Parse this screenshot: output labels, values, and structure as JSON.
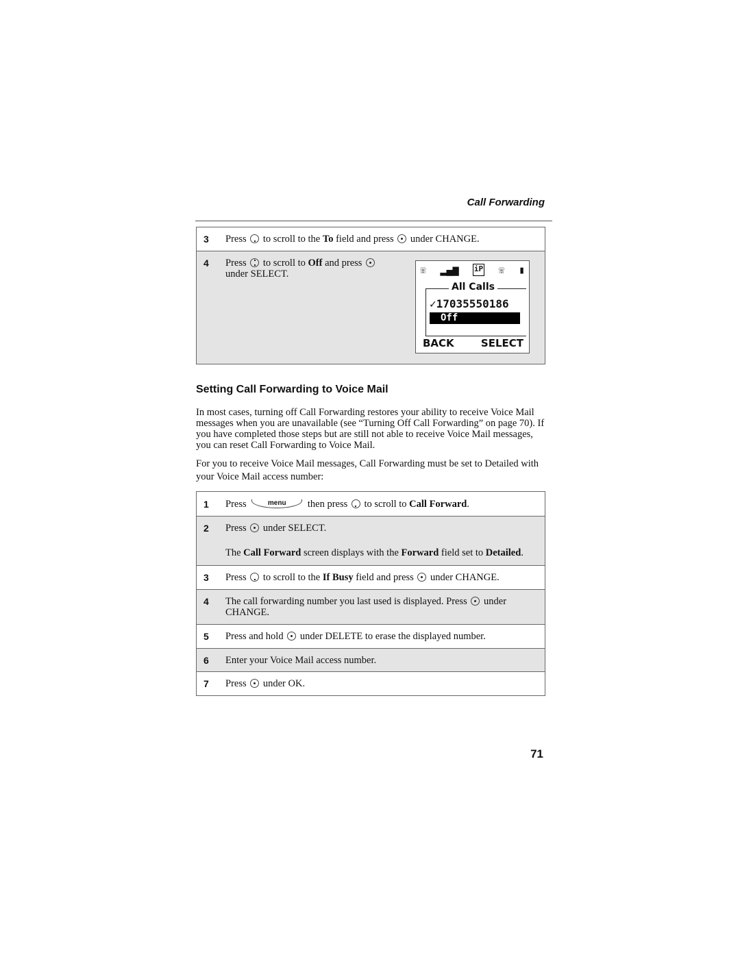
{
  "running_head": "Call Forwarding",
  "top_steps": [
    {
      "num": "3",
      "parts": [
        "Press",
        "to scroll to the",
        "To",
        "field and press",
        "under CHANGE."
      ]
    },
    {
      "num": "4",
      "parts": [
        "Press",
        "to scroll to",
        "Off",
        "and press",
        "under SELECT."
      ]
    }
  ],
  "phone_screen": {
    "status_icons": [
      "phone-icon",
      "signal-icon",
      "ip-icon",
      "phone-icon",
      "battery-icon"
    ],
    "frame_title": "All Calls",
    "check": "✓",
    "number": "17035550186",
    "highlight": "Off",
    "soft_left": "BACK",
    "soft_right": "SELECT"
  },
  "section": {
    "heading": "Setting Call Forwarding to Voice Mail",
    "para1": "In most cases, turning off Call Forwarding restores your ability to receive Voice Mail messages when you are unavailable (see “Turning Off Call Forwarding” on page 70). If you have completed those steps but are still not able to receive Voice Mail messages, you can reset Call Forwarding to Voice Mail.",
    "para2": "For you to receive Voice Mail messages, Call Forwarding must be set to Detailed with your Voice Mail access number:"
  },
  "steps": [
    {
      "num": "1",
      "parts": [
        "Press",
        "menu",
        "then press",
        "to scroll to",
        "Call Forward",
        "."
      ]
    },
    {
      "num": "2",
      "parts": [
        "Press",
        "under SELECT."
      ],
      "note": [
        "The",
        "Call Forward",
        "screen displays with the",
        "Forward",
        "field set to",
        "Detailed",
        "."
      ]
    },
    {
      "num": "3",
      "parts": [
        "Press",
        "to scroll to the",
        "If Busy",
        "field and press",
        "under CHANGE."
      ]
    },
    {
      "num": "4",
      "parts": [
        "The call forwarding number you last used is displayed. Press",
        "under CHANGE."
      ]
    },
    {
      "num": "5",
      "parts": [
        "Press and hold",
        "under DELETE to erase the displayed number."
      ]
    },
    {
      "num": "6",
      "parts": [
        "Enter your Voice Mail access number."
      ]
    },
    {
      "num": "7",
      "parts": [
        "Press",
        "under OK."
      ]
    }
  ],
  "page_number": "71"
}
